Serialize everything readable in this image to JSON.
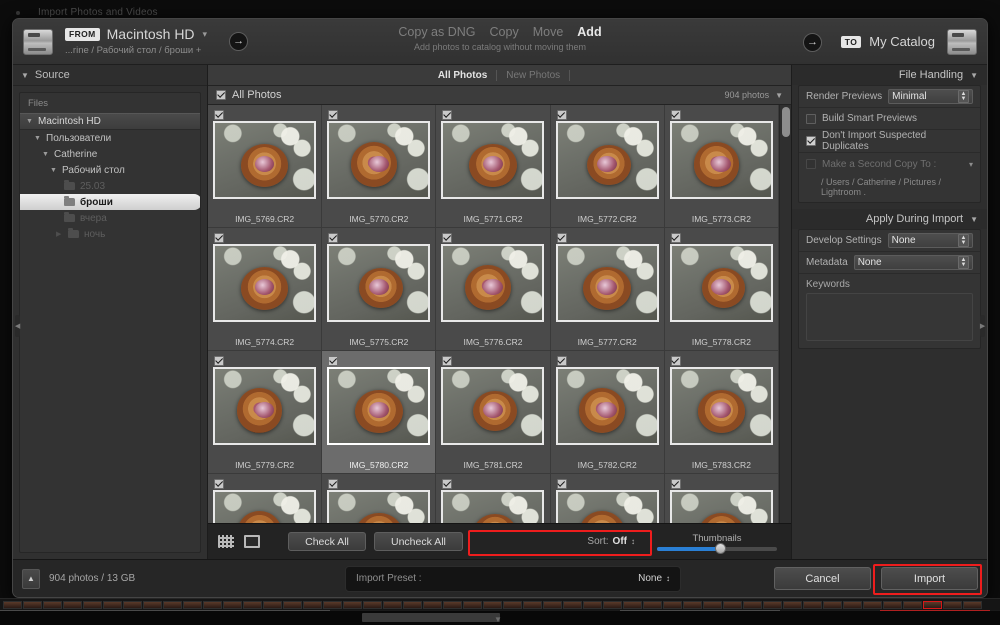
{
  "window": {
    "title": "Import Photos and Videos"
  },
  "topbar": {
    "from_chip": "FROM",
    "from_name": "Macintosh HD",
    "from_path": "...rine / Рабочий стол / броши +",
    "to_chip": "TO",
    "to_name": "My Catalog",
    "arrow": "→",
    "modes": [
      {
        "label": "Copy as DNG",
        "active": false
      },
      {
        "label": "Copy",
        "active": false
      },
      {
        "label": "Move",
        "active": false
      },
      {
        "label": "Add",
        "active": true
      }
    ],
    "mode_subtitle": "Add photos to catalog without moving them"
  },
  "source": {
    "panel_title": "Source",
    "files_label": "Files",
    "tree": [
      {
        "label": "Macintosh HD",
        "level": 0,
        "state": "root"
      },
      {
        "label": "Пользователи",
        "level": 1,
        "state": "normal"
      },
      {
        "label": "Catherine",
        "level": 2,
        "state": "normal"
      },
      {
        "label": "Рабочий стол",
        "level": 3,
        "state": "normal"
      },
      {
        "label": "25.03",
        "level": 4,
        "state": "dim"
      },
      {
        "label": "броши",
        "level": 4,
        "state": "selected"
      },
      {
        "label": "вчера",
        "level": 4,
        "state": "dim"
      },
      {
        "label": "ночь",
        "level": 4,
        "state": "dim"
      }
    ]
  },
  "grid": {
    "tabs": [
      {
        "label": "All Photos",
        "active": true
      },
      {
        "label": "New Photos",
        "active": false
      }
    ],
    "header_label": "All Photos",
    "count_label": "904 photos",
    "cells": [
      {
        "filename": "IMG_5769.CR2",
        "checked": true,
        "selected": false,
        "variant": "v1"
      },
      {
        "filename": "IMG_5770.CR2",
        "checked": true,
        "selected": false,
        "variant": "v2"
      },
      {
        "filename": "IMG_5771.CR2",
        "checked": true,
        "selected": false,
        "variant": "v1"
      },
      {
        "filename": "IMG_5772.CR2",
        "checked": true,
        "selected": false,
        "variant": "v3"
      },
      {
        "filename": "IMG_5773.CR2",
        "checked": true,
        "selected": false,
        "variant": "v2"
      },
      {
        "filename": "IMG_5774.CR2",
        "checked": true,
        "selected": false,
        "variant": "v1"
      },
      {
        "filename": "IMG_5775.CR2",
        "checked": true,
        "selected": false,
        "variant": "v3"
      },
      {
        "filename": "IMG_5776.CR2",
        "checked": true,
        "selected": false,
        "variant": "v2"
      },
      {
        "filename": "IMG_5777.CR2",
        "checked": true,
        "selected": false,
        "variant": "v1"
      },
      {
        "filename": "IMG_5778.CR2",
        "checked": true,
        "selected": false,
        "variant": "v3"
      },
      {
        "filename": "IMG_5779.CR2",
        "checked": true,
        "selected": false,
        "variant": "v2"
      },
      {
        "filename": "IMG_5780.CR2",
        "checked": true,
        "selected": true,
        "variant": "v1"
      },
      {
        "filename": "IMG_5781.CR2",
        "checked": true,
        "selected": false,
        "variant": "v3"
      },
      {
        "filename": "IMG_5782.CR2",
        "checked": true,
        "selected": false,
        "variant": "v2"
      },
      {
        "filename": "IMG_5783.CR2",
        "checked": true,
        "selected": false,
        "variant": "v1"
      },
      {
        "filename": "",
        "checked": true,
        "selected": false,
        "variant": "v2"
      },
      {
        "filename": "",
        "checked": true,
        "selected": false,
        "variant": "v1"
      },
      {
        "filename": "",
        "checked": true,
        "selected": false,
        "variant": "v3"
      },
      {
        "filename": "",
        "checked": true,
        "selected": false,
        "variant": "v2"
      },
      {
        "filename": "",
        "checked": true,
        "selected": false,
        "variant": "v1"
      }
    ]
  },
  "toolbar": {
    "check_all": "Check All",
    "uncheck_all": "Uncheck All",
    "sort_label": "Sort:",
    "sort_value": "Off",
    "thumbnails_label": "Thumbnails"
  },
  "file_handling": {
    "title": "File Handling",
    "render_previews_label": "Render Previews",
    "render_previews_value": "Minimal",
    "build_smart_previews": "Build Smart Previews",
    "build_smart_previews_checked": false,
    "dont_import_duplicates": "Don't Import Suspected Duplicates",
    "dont_import_duplicates_checked": true,
    "second_copy_label": "Make a Second Copy To :",
    "second_copy_checked": false,
    "second_copy_path": "/ Users / Catherine / Pictures / Lightroom ."
  },
  "apply_during_import": {
    "title": "Apply During Import",
    "develop_settings_label": "Develop Settings",
    "develop_settings_value": "None",
    "metadata_label": "Metadata",
    "metadata_value": "None",
    "keywords_label": "Keywords",
    "keywords_value": ""
  },
  "bottom": {
    "count_text": "904 photos / 13 GB",
    "preset_label": "Import Preset :",
    "preset_value": "None",
    "cancel": "Cancel",
    "import": "Import"
  },
  "highlights": {
    "color": "#ee1d1d"
  }
}
